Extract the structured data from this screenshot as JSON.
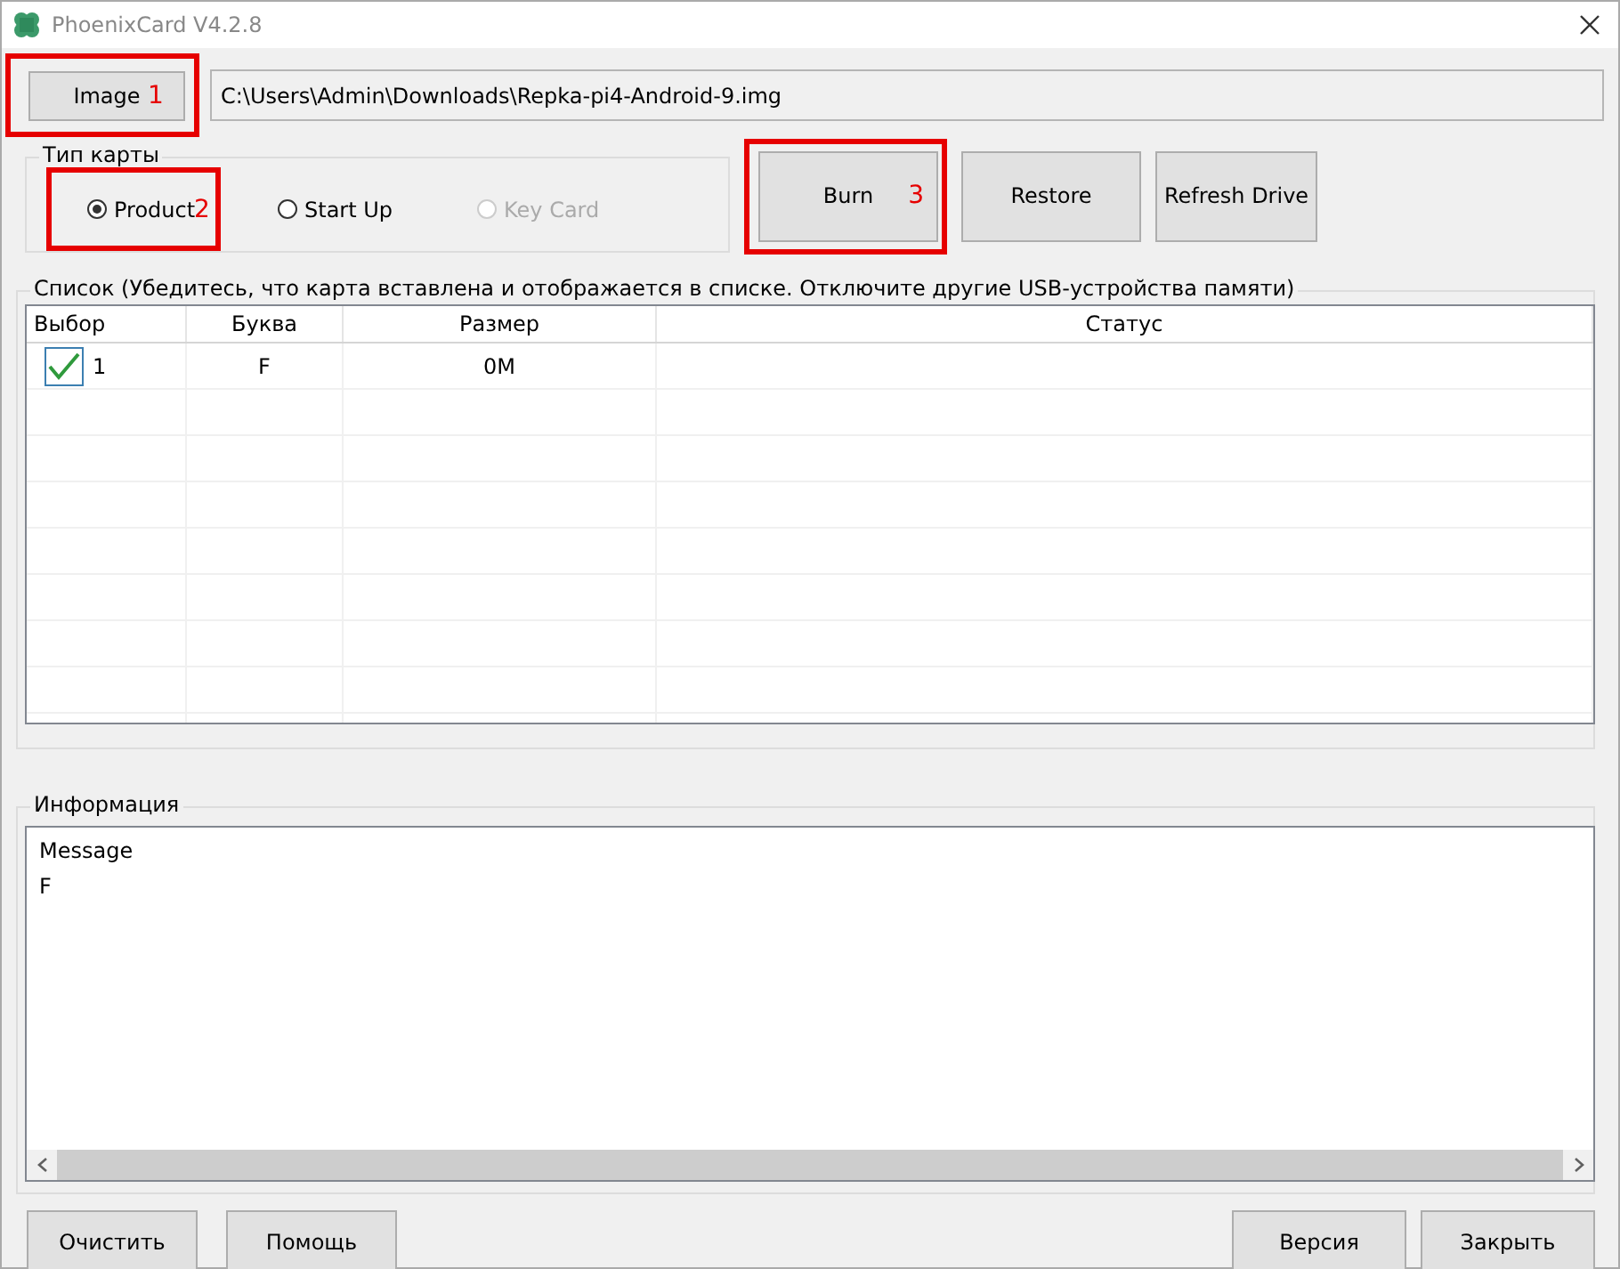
{
  "window": {
    "title": "PhoenixCard V4.2.8"
  },
  "image_button": {
    "label": "Image",
    "annotation": "1"
  },
  "image_path": {
    "value": "C:\\Users\\Admin\\Downloads\\Repka-pi4-Android-9.img"
  },
  "card_type": {
    "label": "Тип карты",
    "options": [
      {
        "label": "Product",
        "selected": true,
        "disabled": false,
        "annotation": "2"
      },
      {
        "label": "Start Up",
        "selected": false,
        "disabled": false
      },
      {
        "label": "Key Card",
        "selected": false,
        "disabled": true
      }
    ]
  },
  "action_buttons": [
    {
      "label": "Burn",
      "annotation": "3"
    },
    {
      "label": "Restore"
    },
    {
      "label": "Refresh Drive"
    }
  ],
  "list": {
    "label": "Список (Убедитесь, что карта вставлена и отображается в списке. Отключите другие USB-устройства памяти)",
    "columns": [
      "Выбор",
      "Буква",
      "Размер",
      "Статус"
    ],
    "rows": [
      {
        "checked": true,
        "number": "1",
        "letter": "F",
        "size": "0M"
      }
    ]
  },
  "info": {
    "label": "Информация",
    "lines": [
      "Message",
      "F"
    ]
  },
  "footer_left": [
    "Очистить",
    "Помощь"
  ],
  "footer_right": [
    "Версия",
    "Закрыть"
  ]
}
